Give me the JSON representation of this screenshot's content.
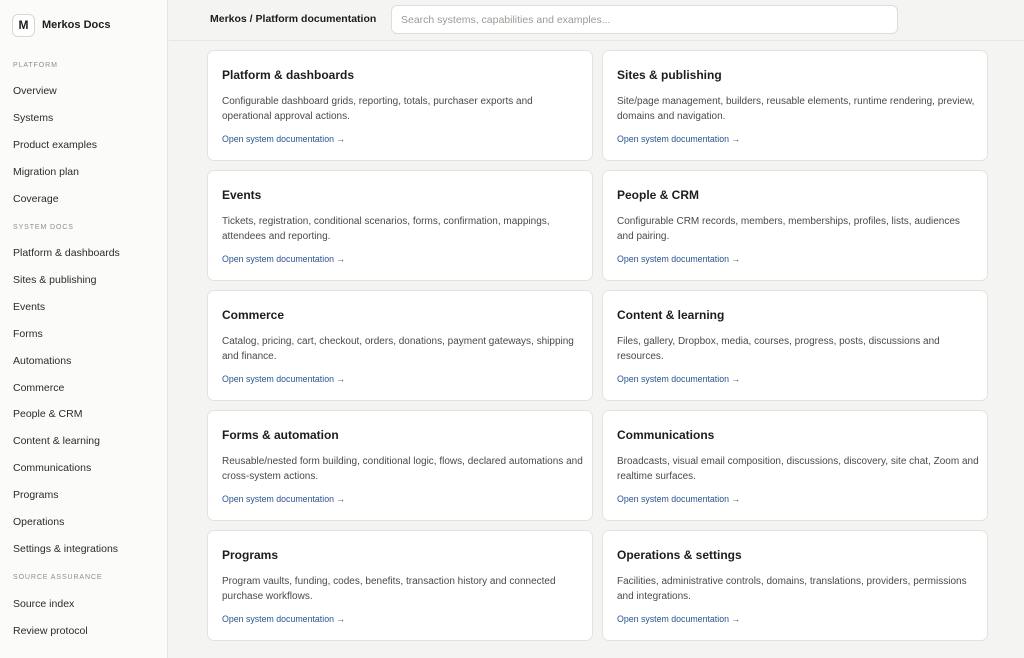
{
  "app": {
    "logo_letter": "M",
    "name": "Merkos Docs"
  },
  "sidebar": {
    "platform_label": "Platform",
    "platform_items": [
      "Overview",
      "Systems",
      "Product examples",
      "Migration plan",
      "Coverage"
    ],
    "system_docs_label": "System docs",
    "system_docs_items": [
      "Platform & dashboards",
      "Sites & publishing",
      "Events",
      "Forms",
      "Automations",
      "Commerce",
      "People & CRM",
      "Content & learning",
      "Communications",
      "Programs",
      "Operations",
      "Settings & integrations"
    ],
    "source_label": "Source assurance",
    "source_items": [
      "Source index",
      "Review protocol"
    ]
  },
  "header": {
    "breadcrumb": "Merkos / Platform documentation",
    "search_placeholder": "Search systems, capabilities and examples..."
  },
  "cards": [
    {
      "title": "Platform & dashboards",
      "description": "Configurable dashboard grids, reporting, totals, purchaser exports and operational approval actions.",
      "link": "Open system documentation →"
    },
    {
      "title": "Sites & publishing",
      "description": "Site/page management, builders, reusable elements, runtime rendering, preview, domains and navigation.",
      "link": "Open system documentation →"
    },
    {
      "title": "Events",
      "description": "Tickets, registration, conditional scenarios, forms, confirmation, mappings, attendees and reporting.",
      "link": "Open system documentation →"
    },
    {
      "title": "People & CRM",
      "description": "Configurable CRM records, members, memberships, profiles, lists, audiences and pairing.",
      "link": "Open system documentation →"
    },
    {
      "title": "Commerce",
      "description": "Catalog, pricing, cart, checkout, orders, donations, payment gateways, shipping and finance.",
      "link": "Open system documentation →"
    },
    {
      "title": "Content & learning",
      "description": "Files, gallery, Dropbox, media, courses, progress, posts, discussions and resources.",
      "link": "Open system documentation →"
    },
    {
      "title": "Forms & automation",
      "description": "Reusable/nested form building, conditional logic, flows, declared automations and cross-system actions.",
      "link": "Open system documentation →"
    },
    {
      "title": "Communications",
      "description": "Broadcasts, visual email composition, discussions, discovery, site chat, Zoom and realtime surfaces.",
      "link": "Open system documentation →"
    },
    {
      "title": "Programs",
      "description": "Program vaults, funding, codes, benefits, transaction history and connected purchase workflows.",
      "link": "Open system documentation →"
    },
    {
      "title": "Operations & settings",
      "description": "Facilities, administrative controls, domains, translations, providers, permissions and integrations.",
      "link": "Open system documentation →"
    }
  ]
}
